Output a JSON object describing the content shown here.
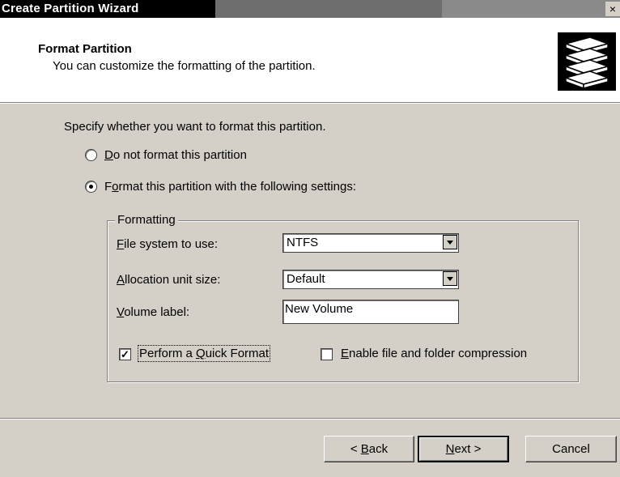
{
  "window": {
    "title": "Create Partition Wizard",
    "close_glyph": "×"
  },
  "header": {
    "title": "Format Partition",
    "subtitle": "You can customize the formatting of the partition.",
    "icon": "disk-stack-icon"
  },
  "instruction": "Specify whether you want to format this partition.",
  "options": {
    "do_not_format": {
      "label_pre": "",
      "label_key": "D",
      "label_post": "o not format this partition",
      "selected": false
    },
    "format": {
      "label_pre": "F",
      "label_key": "o",
      "label_post": "rmat this partition with the following settings:",
      "selected": true
    }
  },
  "formatting": {
    "legend": "Formatting",
    "file_system": {
      "label_key": "F",
      "label_post": "ile system to use:",
      "value": "NTFS"
    },
    "allocation": {
      "label_key": "A",
      "label_post": "llocation unit size:",
      "value": "Default"
    },
    "volume_label": {
      "label_key": "V",
      "label_post": "olume label:",
      "value": "New Volume"
    },
    "quick_format": {
      "label_pre": "Perform a ",
      "label_key": "Q",
      "label_post": "uick Format",
      "checked": true,
      "check_glyph": "✓"
    },
    "compression": {
      "label_key": "E",
      "label_post": "nable file and folder compression",
      "checked": false
    }
  },
  "buttons": {
    "back": {
      "label_pre": "< ",
      "label_key": "B",
      "label_post": "ack"
    },
    "next": {
      "label_key": "N",
      "label_post": "ext >"
    },
    "cancel": {
      "label": "Cancel"
    }
  }
}
